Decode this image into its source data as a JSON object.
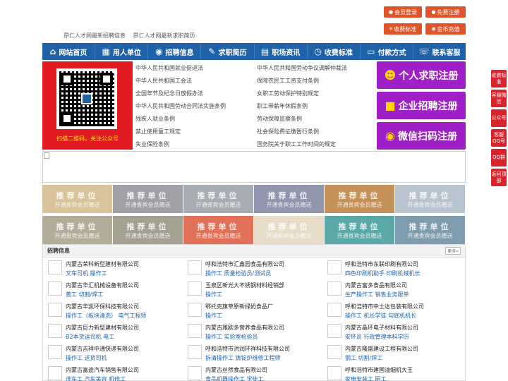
{
  "top_buttons": [
    {
      "icon": "user-icon",
      "label": "会员登录"
    },
    {
      "icon": "user-plus-icon",
      "label": "免费注册"
    },
    {
      "icon": "yen-icon",
      "label": "收费标准"
    },
    {
      "icon": "coin-icon",
      "label": "金币充值"
    }
  ],
  "top_links": [
    "昂仁人才网最新招聘信息",
    "昂仁人才网最新求职简历"
  ],
  "nav": [
    {
      "icon": "⌂",
      "label": "网站首页"
    },
    {
      "icon": "▦",
      "label": "用人单位"
    },
    {
      "icon": "◉",
      "label": "招聘信息"
    },
    {
      "icon": "✎",
      "label": "求职简历"
    },
    {
      "icon": "▤",
      "label": "职场资讯"
    },
    {
      "icon": "◷",
      "label": "收费标准"
    },
    {
      "icon": "▭",
      "label": "付款方式"
    },
    {
      "icon": "☏",
      "label": "联系客服"
    }
  ],
  "qr_caption": "扫描二维码，关注公众号",
  "laws": [
    "中华人民共和国就业促进法",
    "中华人民共和国劳动争议调解仲裁法",
    "中华人民共和国工会法",
    "保障农民工工资支付条例",
    "全国年节及纪念日放假办法",
    "女职工劳动保护特别规定",
    "中华人民共和国劳动合同法实施条例",
    "职工带薪年休假条例",
    "残疾人就业条例",
    "劳动保障监察条例",
    "禁止使用童工规定",
    "社会保险费征缴暂行条例",
    "失业保险条例",
    "国务院关于职工工作时间的规定"
  ],
  "register": [
    {
      "label": "个人求职注册",
      "icon": "person-icon"
    },
    {
      "label": "企业招聘注册",
      "icon": "company-person-icon"
    },
    {
      "label": "微信扫码注册",
      "icon": "wechat-icon"
    }
  ],
  "recommend": {
    "title": "推荐单位",
    "subtitle": "开通贵宾会员赠送",
    "colors": [
      "#d8c39a",
      "#9fa1a6",
      "#a8adb4",
      "#9096ae",
      "#c49158",
      "#b8c4d0",
      "#b4ac9a",
      "#a4a092",
      "#e07058",
      "#e8dcc8",
      "#5aa8a8",
      "#7e9cae"
    ]
  },
  "jobs_title": "招聘信息",
  "more_label": "更多»",
  "jobs": [
    {
      "company": "内蒙古荣科新型建材有限公司",
      "positions": "叉车司机 操作工"
    },
    {
      "company": "呼和浩特市汇鑫园食品有限公司",
      "positions": "操作工 质量检验员/测试员"
    },
    {
      "company": "呼和浩特市东联印刷有限公司",
      "positions": "四色印刷机助手 印刷机械机长"
    },
    {
      "company": "内蒙古华汇机械设备有限公司",
      "positions": "普工 切割/焊工"
    },
    {
      "company": "玉泉区新光大不锈钢材料经销部",
      "positions": "操作工"
    },
    {
      "company": "内蒙古富多食品有限公司",
      "positions": "生产操作工 销售业务跟单"
    },
    {
      "company": "内蒙古华凯环保科技有限公司",
      "positions": "操作工（板块清洗） 电气工程师"
    },
    {
      "company": "鄂托克旗草原新绿奶食品厂",
      "positions": "操作工"
    },
    {
      "company": "呼和浩特市中士达包装有限公司",
      "positions": "操作工 机长学徒 勾底机机长"
    },
    {
      "company": "内蒙古巨力新型建材有限公司",
      "positions": "B2本货运司机 电工"
    },
    {
      "company": "内蒙古雅欧多营养食品有限公司",
      "positions": "操作工 实验室检验员"
    },
    {
      "company": "内蒙古晶环电子材料有限公司",
      "positions": "安环员 行政管理本科学历"
    },
    {
      "company": "内蒙古吉祥中通快递有限公司",
      "positions": "操作工 送货司机"
    },
    {
      "company": "呼和浩特市洪润环祥科技有限公司",
      "positions": "拆清操作工 铸锭炉维修工程师"
    },
    {
      "company": "内蒙古隆盛建设工程有限公司",
      "positions": "钢工 切割/焊工"
    },
    {
      "company": "内蒙古富途汽车销售有限公司",
      "positions": "洗车工 汽车美容 机修工"
    },
    {
      "company": "内蒙古丝然食品有限公司",
      "positions": "食品机器操作工 学徒工"
    },
    {
      "company": "呼和浩特市建国油烟机大王",
      "positions": "家电安装工 厨工"
    }
  ],
  "side_float": [
    "收费标准",
    "客服微信",
    "公众号",
    "客服QQ号",
    "QQ群",
    "返回顶部"
  ],
  "colors": {
    "nav": "#1f62a8",
    "accent": "#e0542a",
    "register": "#a020c8",
    "side": "#d9232d"
  }
}
